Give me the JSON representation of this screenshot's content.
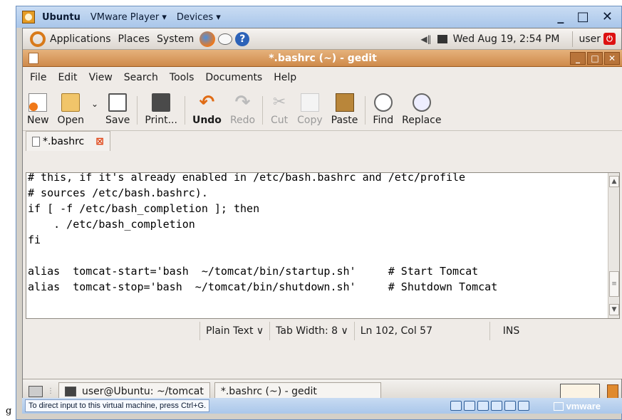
{
  "stray_char": "g",
  "vmware": {
    "os_name": "Ubuntu",
    "menu_player": "VMware Player ▾",
    "menu_devices": "Devices ▾",
    "controls": "_ □ ✕",
    "status_hint": "To direct input to this virtual machine, press Ctrl+G.",
    "brand": "vmware"
  },
  "top_panel": {
    "applications": "Applications",
    "places": "Places",
    "system": "System",
    "help_glyph": "?",
    "volume_glyph": "◀‖",
    "clock": "Wed Aug 19,  2:54 PM",
    "user": "user"
  },
  "gedit": {
    "title": "*.bashrc (~) - gedit",
    "win_controls": [
      "_",
      "□",
      "✕"
    ],
    "menu": [
      "File",
      "Edit",
      "View",
      "Search",
      "Tools",
      "Documents",
      "Help"
    ],
    "toolbar": {
      "new": "New",
      "open": "Open",
      "save": "Save",
      "print": "Print...",
      "undo": "Undo",
      "redo": "Redo",
      "cut": "Cut",
      "copy": "Copy",
      "paste": "Paste",
      "find": "Find",
      "replace": "Replace"
    },
    "tab_label": "*.bashrc",
    "tab_close": "⊠",
    "code": "# this, if it's already enabled in /etc/bash.bashrc and /etc/profile\n# sources /etc/bash.bashrc).\nif [ -f /etc/bash_completion ]; then\n    . /etc/bash_completion\nfi\n\nalias  tomcat-start='bash  ~/tomcat/bin/startup.sh'     # Start Tomcat\nalias  tomcat-stop='bash  ~/tomcat/bin/shutdown.sh'     # Shutdown Tomcat\n",
    "status": {
      "language": "Plain Text ∨",
      "tab_width": "Tab Width:  8 ∨",
      "position": "Ln 102, Col 57",
      "mode": "INS"
    }
  },
  "bottom_panel": {
    "dots": "⋮",
    "task_terminal": "user@Ubuntu: ~/tomcat",
    "task_gedit": "*.bashrc (~) - gedit"
  }
}
